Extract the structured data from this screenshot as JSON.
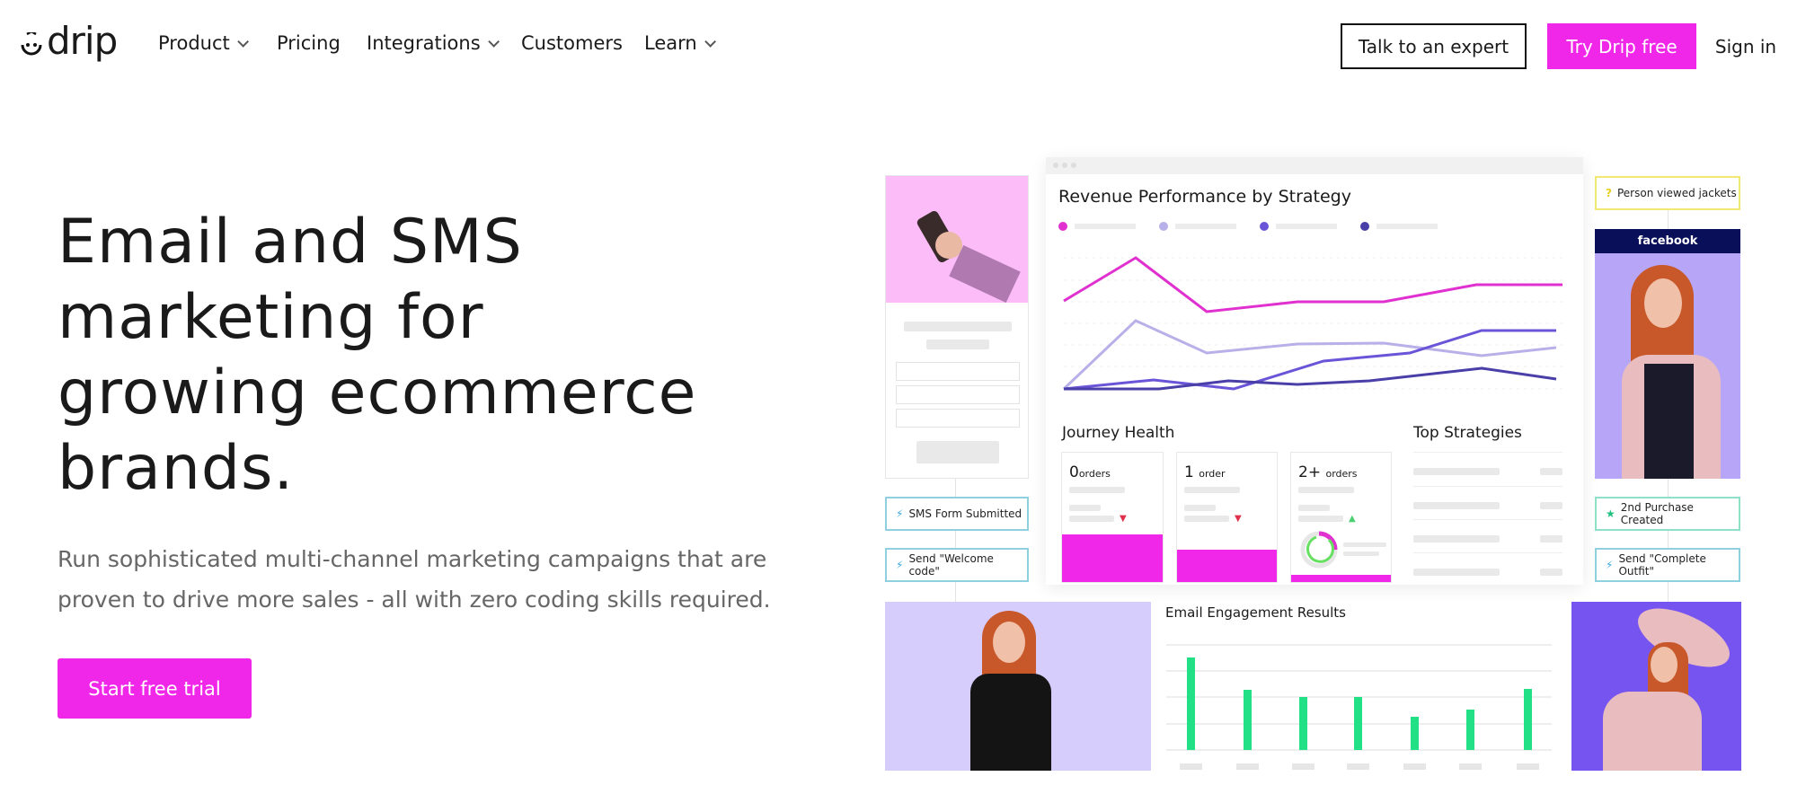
{
  "header": {
    "logo": "drip",
    "nav": [
      {
        "label": "Product",
        "dropdown": true
      },
      {
        "label": "Pricing",
        "dropdown": false
      },
      {
        "label": "Integrations",
        "dropdown": true
      },
      {
        "label": "Customers",
        "dropdown": false
      },
      {
        "label": "Learn",
        "dropdown": true
      }
    ],
    "talk_button": "Talk to an expert",
    "try_button": "Try Drip free",
    "sign_in": "Sign in"
  },
  "hero": {
    "headline": "Email and SMS marketing for growing ecommerce brands.",
    "subtext": "Run sophisticated multi-channel marketing campaigns that are proven to drive more sales - all with zero coding skills required.",
    "cta": "Start free trial"
  },
  "illustration": {
    "dashboard_title": "Revenue Performance by Strategy",
    "journey_title": "Journey Health",
    "top_strategies_title": "Top Strategies",
    "journey_cards": [
      {
        "num": "0",
        "unit": "orders",
        "trend": "down"
      },
      {
        "num": "1",
        "unit": "order",
        "trend": "down"
      },
      {
        "num": "2+",
        "unit": "orders",
        "trend": "up"
      }
    ],
    "pills": {
      "sms_form": "SMS Form Submitted",
      "welcome": "Send \"Welcome code\"",
      "viewed": "Person viewed jackets",
      "purchase": "2nd Purchase Created",
      "outfit": "Send \"Complete Outfit\""
    },
    "facebook_label": "facebook",
    "email_title": "Email Engagement Results"
  },
  "colors": {
    "brand_pink": "#f026e8",
    "line_magenta": "#e030d0",
    "line_lavender": "#b8b0e8",
    "line_purple": "#6a55d8",
    "line_dark": "#4a3fa8",
    "bar_green": "#22e085",
    "pill_blue": "#8fd0e0",
    "pill_yellow": "#f0e870",
    "pill_green": "#8fe0c8",
    "facebook_navy": "#0a0f5a"
  }
}
